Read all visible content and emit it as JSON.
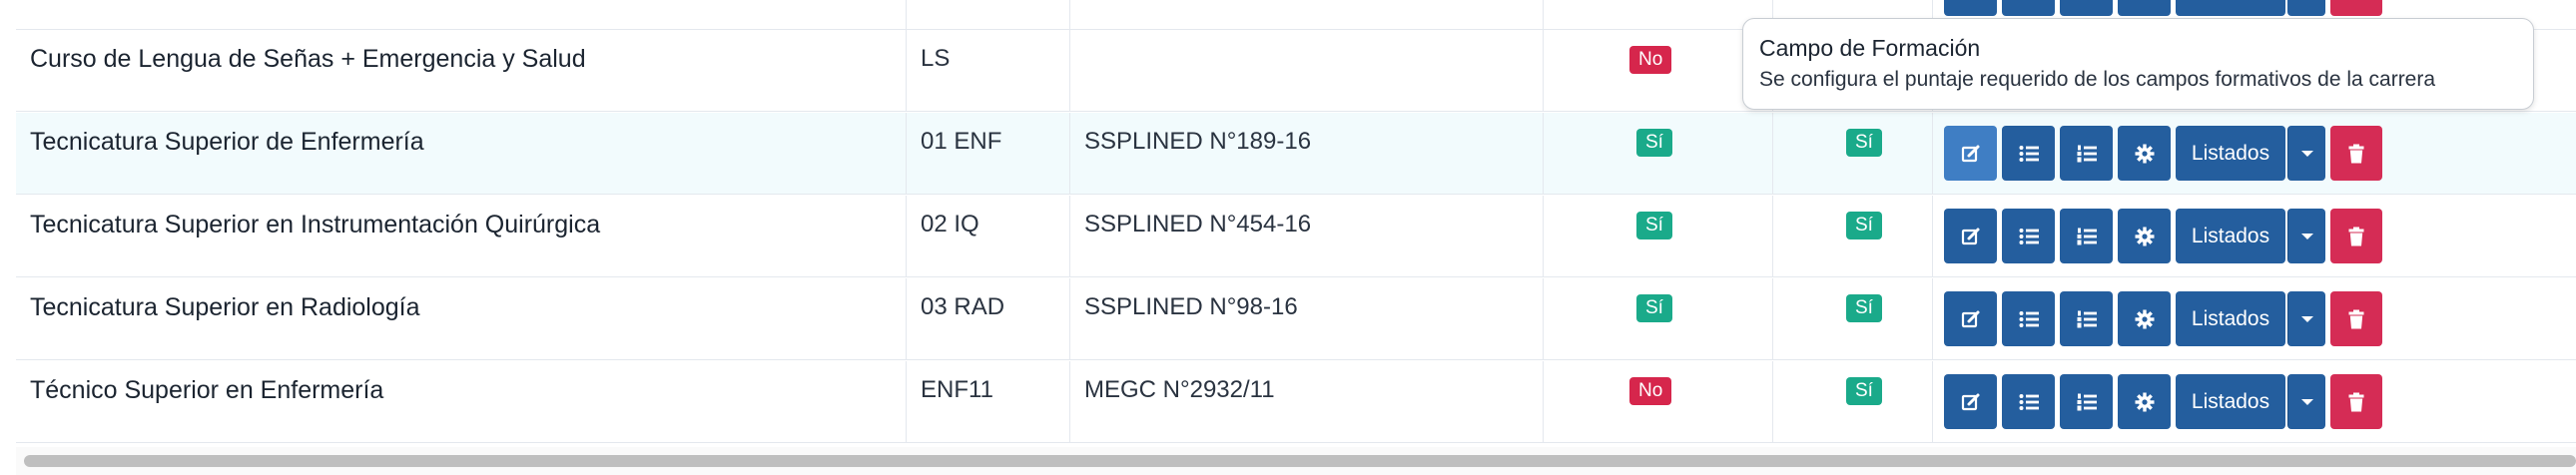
{
  "rows": [
    {
      "name": "",
      "code": "",
      "resolution": "",
      "flag1": "",
      "flag2": ""
    },
    {
      "name": "Curso de Lengua de Señas + Emergencia y Salud",
      "code": "LS",
      "resolution": "",
      "flag1": "No",
      "flag2": ""
    },
    {
      "name": "Tecnicatura Superior de Enfermería",
      "code": "01 ENF",
      "resolution": "SSPLINED N°189-16",
      "flag1": "Sí",
      "flag2": "Sí"
    },
    {
      "name": "Tecnicatura Superior en Instrumentación Quirúrgica",
      "code": "02 IQ",
      "resolution": "SSPLINED N°454-16",
      "flag1": "Sí",
      "flag2": "Sí"
    },
    {
      "name": "Tecnicatura Superior en Radiología",
      "code": "03 RAD",
      "resolution": "SSPLINED N°98-16",
      "flag1": "Sí",
      "flag2": "Sí"
    },
    {
      "name": "Técnico Superior en Enfermería",
      "code": "ENF11",
      "resolution": "MEGC N°2932/11",
      "flag1": "No",
      "flag2": "Sí"
    }
  ],
  "actions": {
    "listados_label": "Listados",
    "icons": [
      "edit-icon",
      "list-icon",
      "ordered-list-icon",
      "gear-icon",
      "caret-down-icon",
      "trash-icon"
    ]
  },
  "tooltip": {
    "title": "Campo de Formación",
    "body": "Se configura el puntaje requerido de los campos formativos de la carrera"
  },
  "colors": {
    "primary": "#245e9e",
    "active": "#3f7ec4",
    "danger": "#d52c55",
    "yes": "#1aaa8a",
    "no": "#d6264c"
  }
}
